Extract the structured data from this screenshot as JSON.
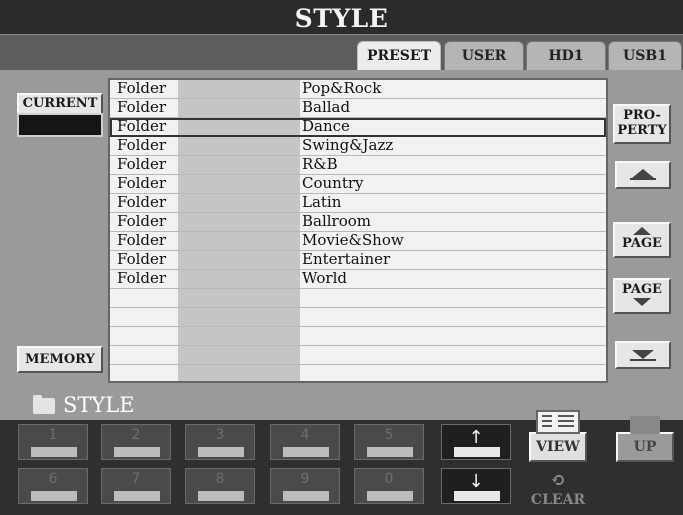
{
  "header": {
    "title": "STYLE"
  },
  "tabs": [
    "PRESET",
    "USER",
    "HD1",
    "USB1"
  ],
  "active_tab": "PRESET",
  "left_buttons": {
    "current": "CURRENT",
    "memory": "MEMORY"
  },
  "list": {
    "selected_index": 2,
    "rows": [
      {
        "type": "Folder",
        "name": "Pop&Rock"
      },
      {
        "type": "Folder",
        "name": "Ballad"
      },
      {
        "type": "Folder",
        "name": "Dance"
      },
      {
        "type": "Folder",
        "name": "Swing&Jazz"
      },
      {
        "type": "Folder",
        "name": "R&B"
      },
      {
        "type": "Folder",
        "name": "Country"
      },
      {
        "type": "Folder",
        "name": "Latin"
      },
      {
        "type": "Folder",
        "name": "Ballroom"
      },
      {
        "type": "Folder",
        "name": "Movie&Show"
      },
      {
        "type": "Folder",
        "name": "Entertainer"
      },
      {
        "type": "Folder",
        "name": "World"
      },
      {
        "type": "",
        "name": ""
      },
      {
        "type": "",
        "name": ""
      },
      {
        "type": "",
        "name": ""
      },
      {
        "type": "",
        "name": ""
      },
      {
        "type": "",
        "name": ""
      }
    ]
  },
  "right_buttons": {
    "property_line1": "PRO-",
    "property_line2": "PERTY",
    "page": "PAGE"
  },
  "folder_path": "STYLE",
  "bottom": {
    "top_numbers": [
      "1",
      "2",
      "3",
      "4",
      "5"
    ],
    "bottom_numbers": [
      "6",
      "7",
      "8",
      "9",
      "0"
    ],
    "view": "VIEW",
    "up": "UP",
    "clear": "CLEAR"
  },
  "icons": {
    "folder": "folder-icon",
    "arrow_up": "arrow-up-icon",
    "arrow_down": "arrow-down-icon"
  }
}
